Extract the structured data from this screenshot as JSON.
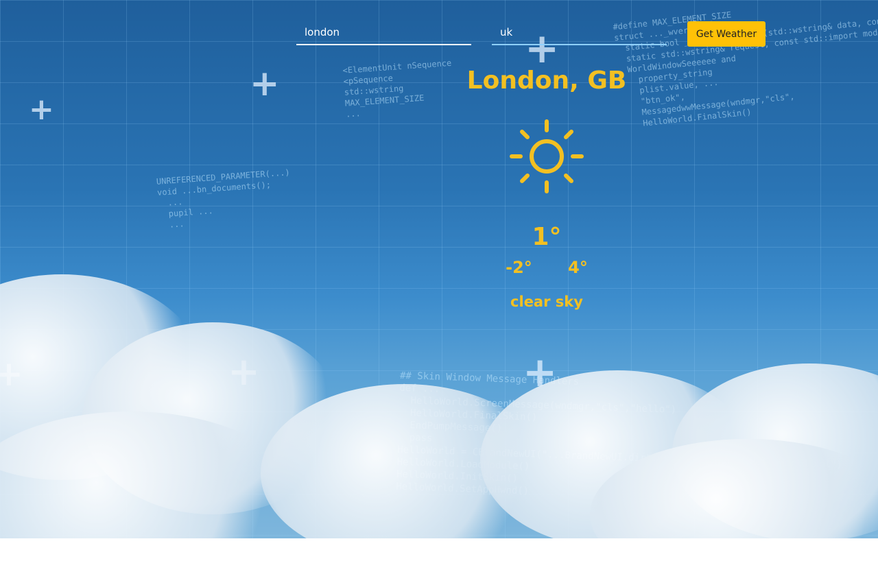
{
  "form": {
    "city_value": "london",
    "country_value": "uk",
    "button_label": "Get Weather"
  },
  "weather": {
    "location": "London, GB",
    "icon": "sun-icon",
    "temperature": "1°",
    "min_temp": "-2°",
    "max_temp": "4°",
    "description": "clear sky"
  },
  "colors": {
    "accent": "#ffc107",
    "text_accent": "#f3c022"
  }
}
